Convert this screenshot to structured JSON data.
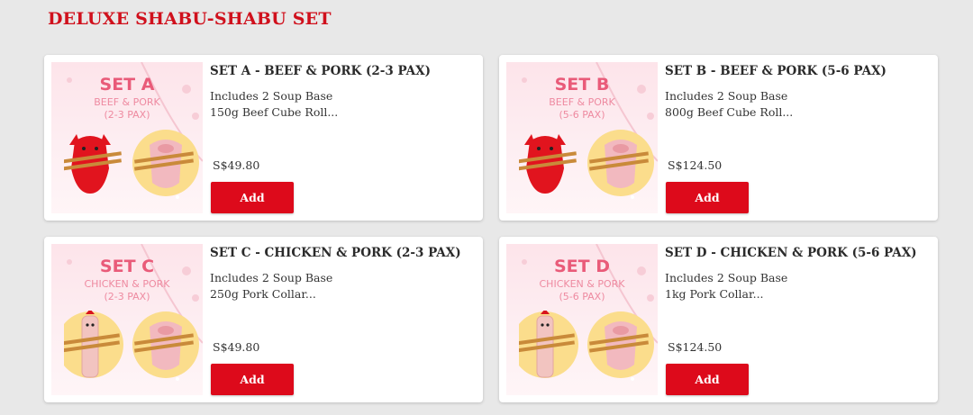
{
  "section": {
    "title": "DELUXE SHABU-SHABU SET"
  },
  "products": [
    {
      "image": {
        "set_name": "SET A",
        "subtitle": "BEEF & PORK\n(2-3 PAX)",
        "left_icon": "bull-chopsticks-icon",
        "right_icon": "pig-chopsticks-icon"
      },
      "title": "SET A - BEEF & PORK (2-3 PAX)",
      "desc_line1": "Includes 2 Soup Base",
      "desc_line2": "150g Beef Cube Roll...",
      "price": "S$49.80",
      "add_label": "Add"
    },
    {
      "image": {
        "set_name": "SET B",
        "subtitle": "BEEF & PORK\n(5-6 PAX)",
        "left_icon": "bull-chopsticks-icon",
        "right_icon": "pig-chopsticks-icon"
      },
      "title": "SET B - BEEF & PORK (5-6 PAX)",
      "desc_line1": "Includes 2 Soup Base",
      "desc_line2": "800g Beef Cube Roll...",
      "price": "S$124.50",
      "add_label": "Add"
    },
    {
      "image": {
        "set_name": "SET C",
        "subtitle": "CHICKEN & PORK\n(2-3 PAX)",
        "left_icon": "chicken-chopsticks-icon",
        "right_icon": "pig-chopsticks-icon"
      },
      "title": "SET C - CHICKEN & PORK (2-3 PAX)",
      "desc_line1": "Includes 2 Soup Base",
      "desc_line2": "250g Pork Collar...",
      "price": "S$49.80",
      "add_label": "Add"
    },
    {
      "image": {
        "set_name": "SET D",
        "subtitle": "CHICKEN & PORK\n(5-6 PAX)",
        "left_icon": "chicken-chopsticks-icon",
        "right_icon": "pig-chopsticks-icon"
      },
      "title": "SET D - CHICKEN & PORK (5-6 PAX)",
      "desc_line1": "Includes 2 Soup Base",
      "desc_line2": "1kg Pork Collar...",
      "price": "S$124.50",
      "add_label": "Add"
    }
  ],
  "colors": {
    "brand_red": "#dd0a1b",
    "heading_red": "#d0101c",
    "thumb_pink": "#e95b79",
    "thumb_bg": "#fde4ea",
    "circle_yellow": "#fbdd8c"
  }
}
